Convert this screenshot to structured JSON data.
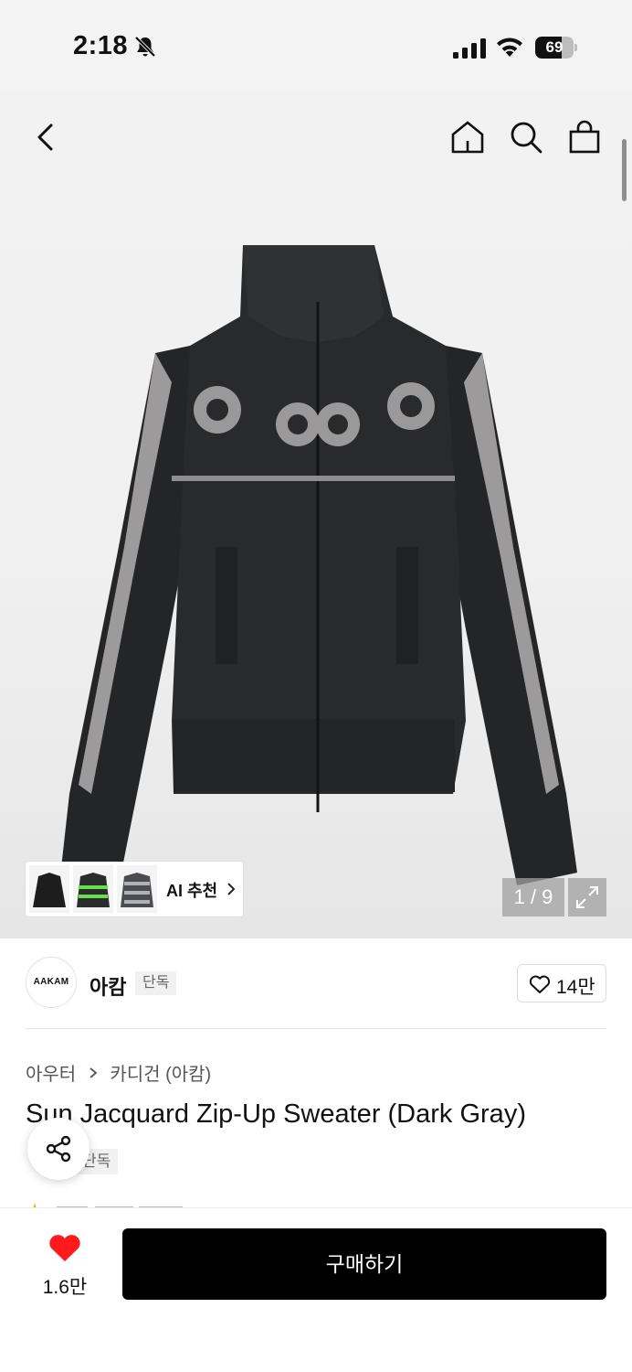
{
  "status_bar": {
    "time": "2:18",
    "battery_level": "69",
    "icons": [
      "bell-off-icon",
      "signal-icon",
      "wifi-icon",
      "battery-icon"
    ]
  },
  "nav": {
    "icons": [
      "back-arrow-icon",
      "home-icon",
      "search-icon",
      "shopping-bag-icon"
    ]
  },
  "gallery": {
    "counter": "1 / 9",
    "ai_label": "AI 추천",
    "expand_icon": "expand-icon"
  },
  "brand": {
    "logo_text": "AAKAM",
    "name": "아캄",
    "tag": "단독",
    "like_count": "14만"
  },
  "product": {
    "breadcrumb": [
      "아우터",
      "카디건 (아캄)"
    ],
    "title": "Sun Jacquard Zip-Up Sweater (Dark Gray)",
    "tag": "단독"
  },
  "bottom_bar": {
    "wish_count": "1.6만",
    "buy_label": "구매하기"
  },
  "colors": {
    "accent_red": "#ff1b1b",
    "button_black": "#000000",
    "sweater_body": "#26282a",
    "sleeve_gray": "#9c9a9a"
  }
}
